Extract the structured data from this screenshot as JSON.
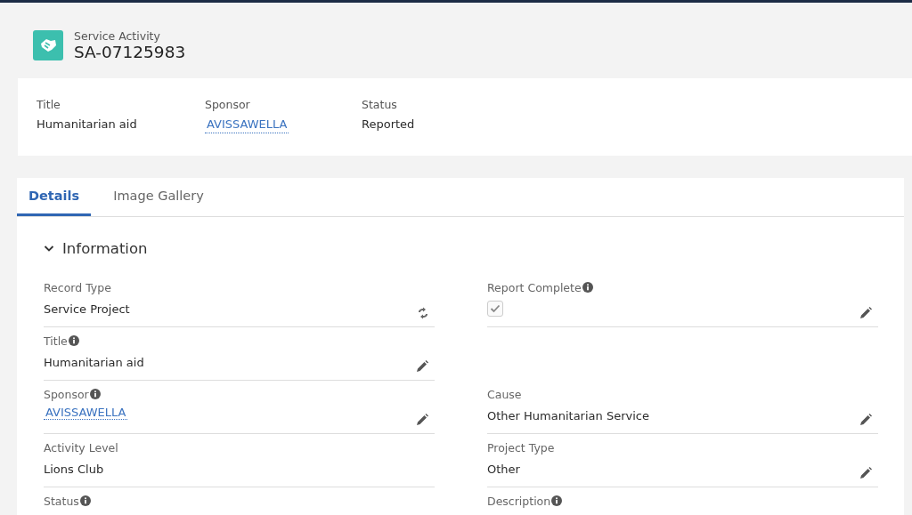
{
  "header": {
    "object_type": "Service Activity",
    "record_name": "SA-07125983"
  },
  "highlights": [
    {
      "label": "Title",
      "value": "Humanitarian aid",
      "kind": "text"
    },
    {
      "label": "Sponsor",
      "value": "AVISSAWELLA",
      "kind": "link"
    },
    {
      "label": "Status",
      "value": "Reported",
      "kind": "text"
    }
  ],
  "tabs": [
    {
      "label": "Details",
      "selected": true
    },
    {
      "label": "Image Gallery",
      "selected": false
    }
  ],
  "section": {
    "title": "Information",
    "expanded": true
  },
  "rows": [
    {
      "left": {
        "label": "Record Type",
        "info": false,
        "kind": "record_type",
        "value": "Service Project"
      },
      "right": {
        "label": "Report Complete",
        "info": true,
        "kind": "checkbox",
        "checked": true,
        "editable": true
      }
    },
    {
      "left": {
        "label": "Title",
        "info": true,
        "kind": "text",
        "value": "Humanitarian aid",
        "editable": true
      }
    },
    {
      "left": {
        "label": "Sponsor",
        "info": true,
        "kind": "link",
        "value": "AVISSAWELLA",
        "editable": true
      },
      "right": {
        "label": "Cause",
        "info": false,
        "kind": "text",
        "value": "Other Humanitarian Service",
        "editable": true
      }
    },
    {
      "left": {
        "label": "Activity Level",
        "info": false,
        "kind": "text",
        "value": "Lions Club",
        "editable": false
      },
      "right": {
        "label": "Project Type",
        "info": false,
        "kind": "text",
        "value": "Other",
        "editable": true
      }
    },
    {
      "left": {
        "label": "Status",
        "info": true,
        "kind": "text"
      },
      "right": {
        "label": "Description",
        "info": true,
        "kind": "text"
      }
    }
  ]
}
